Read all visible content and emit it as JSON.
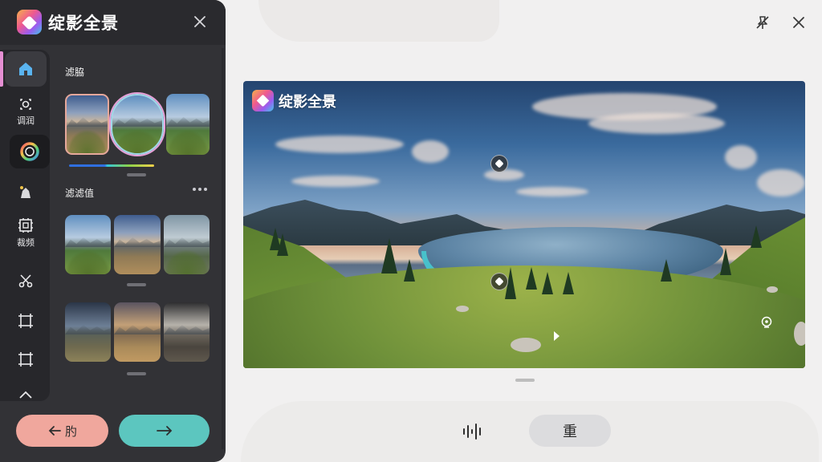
{
  "app": {
    "title": "绽影全景"
  },
  "rail": {
    "items": [
      {
        "icon": "home-icon",
        "label": ""
      },
      {
        "icon": "adjust-icon",
        "label": "调润"
      },
      {
        "icon": "color-wheel-icon",
        "label": ""
      },
      {
        "icon": "magic-icon",
        "label": ""
      },
      {
        "icon": "crop-icon",
        "label": "裁频"
      },
      {
        "icon": "scissors-icon",
        "label": ""
      },
      {
        "icon": "frame-icon",
        "label": ""
      },
      {
        "icon": "frame-alt-icon",
        "label": ""
      },
      {
        "icon": "chevron-up-icon",
        "label": ""
      }
    ]
  },
  "sections": {
    "presets_title": "滤脇",
    "filters_title": "滤滤值"
  },
  "buttons": {
    "back_label": "肑",
    "redo_label": "重"
  },
  "viewer": {
    "watermark": "绽影全景"
  },
  "colors": {
    "panel_bg": "#323236",
    "accent_pink": "#e58fd3",
    "back_button": "#f0a79d",
    "next_button": "#5cc6bf"
  }
}
